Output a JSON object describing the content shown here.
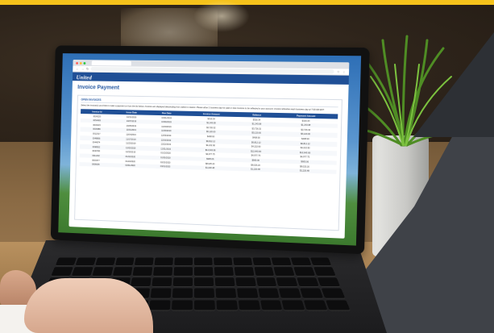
{
  "browser": {
    "tab_title": "",
    "url": ""
  },
  "header": {
    "logo_text": "United",
    "logo_sub": "",
    "nav": [
      "",
      ""
    ],
    "right_links": [
      "",
      ""
    ]
  },
  "page": {
    "title": "Invoice Payment"
  },
  "open_invoices": {
    "section_title": "OPEN INVOICES",
    "instructions": "Select the invoice(s) you'd like to make a payment on from the list below. Invoices are displayed descending from oldest to newest. Please allow 1 business day for paid or new invoices to be reflected in your account. Invoice refreshes each business day at 7:00 AM EST.",
    "columns": [
      "Invoice Id",
      "Issue Date",
      "Due Date",
      "Invoice Amount",
      "Balance",
      "Payment Amount"
    ],
    "rows": [
      [
        "0024220",
        "10/31/2019",
        "10/31/2019",
        "$316.34",
        "$316.34",
        "$316.34"
      ],
      [
        "0054469",
        "10/07/2019",
        "10/30/2019",
        "$1,243.08",
        "$1,243.08",
        "$1,243.08"
      ],
      [
        "0033415",
        "10/25/2019",
        "11/23/2019",
        "$3,726.32",
        "$3,726.32",
        "$3,726.32"
      ],
      [
        "0034986",
        "11/01/2019",
        "11/30/2019",
        "$5,120.00",
        "$5,120.00",
        "$5,120.00"
      ],
      [
        "0012317",
        "11/04/2019",
        "12/03/2019",
        "$408.90",
        "$408.90",
        "$408.90"
      ],
      [
        "0048855",
        "11/17/2019",
        "12/16/2019",
        "$6,812.12",
        "$6,812.12",
        "$6,812.12"
      ],
      [
        "0044874",
        "11/23/2019",
        "12/22/2019",
        "$4,222.90",
        "$4,222.90",
        "$4,222.90"
      ],
      [
        "0098652",
        "12/02/2019",
        "12/31/2019",
        "$12,643.66",
        "$12,643.66",
        "$12,643.66"
      ],
      [
        "0036788",
        "12/15/2019",
        "01/13/2020",
        "$4,977.75",
        "$4,977.75",
        "$4,977.75"
      ],
      [
        "0011232",
        "01/02/2020",
        "01/30/2020",
        "$905.06",
        "$905.06",
        "$905.06"
      ],
      [
        "0003477",
        "01/23/2020",
        "02/22/2020",
        "$8,025.20",
        "$8,025.20",
        "$8,025.20"
      ],
      [
        "0006005",
        "02/01/2020",
        "03/01/2020",
        "$1,220.48",
        "$1,220.48",
        "$1,220.48"
      ]
    ]
  },
  "colors": {
    "brand_blue": "#1f4f96",
    "title_blue": "#2a5ca4",
    "top_band": "#f5c21b",
    "dark_panel": "#3f4248"
  }
}
